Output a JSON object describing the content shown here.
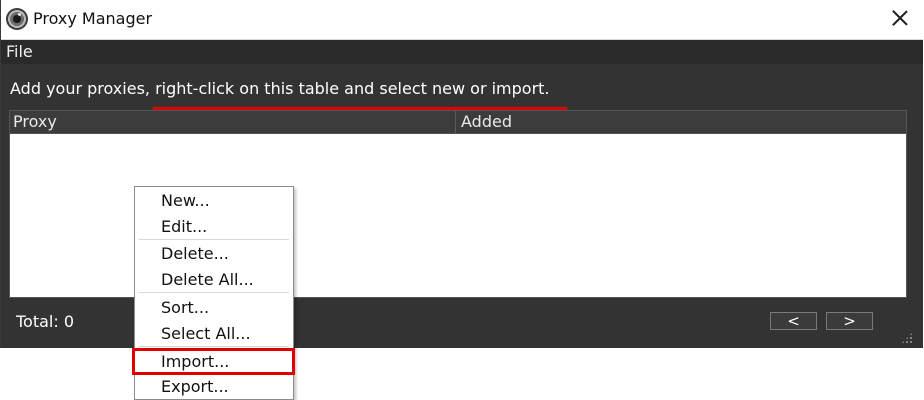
{
  "window": {
    "title": "Proxy Manager",
    "icon": "webcam-app-icon"
  },
  "menubar": {
    "file": "File"
  },
  "instruction": "Add your proxies, right-click on this table and select new or import.",
  "table": {
    "columns": [
      "Proxy",
      "Added"
    ],
    "rows": []
  },
  "footer": {
    "total": "Total: 0",
    "prev": "<",
    "next": ">"
  },
  "context_menu": {
    "items": [
      {
        "label": "New..."
      },
      {
        "label": "Edit..."
      },
      {
        "label": "Delete..."
      },
      {
        "label": "Delete All..."
      },
      {
        "label": "Sort..."
      },
      {
        "label": "Select All..."
      },
      {
        "label": "Import..."
      },
      {
        "label": "Export..."
      }
    ],
    "highlighted_item": "Import..."
  },
  "colors": {
    "window_bg": "#333333",
    "accent_red": "#e00000",
    "table_bg": "#ffffff"
  }
}
